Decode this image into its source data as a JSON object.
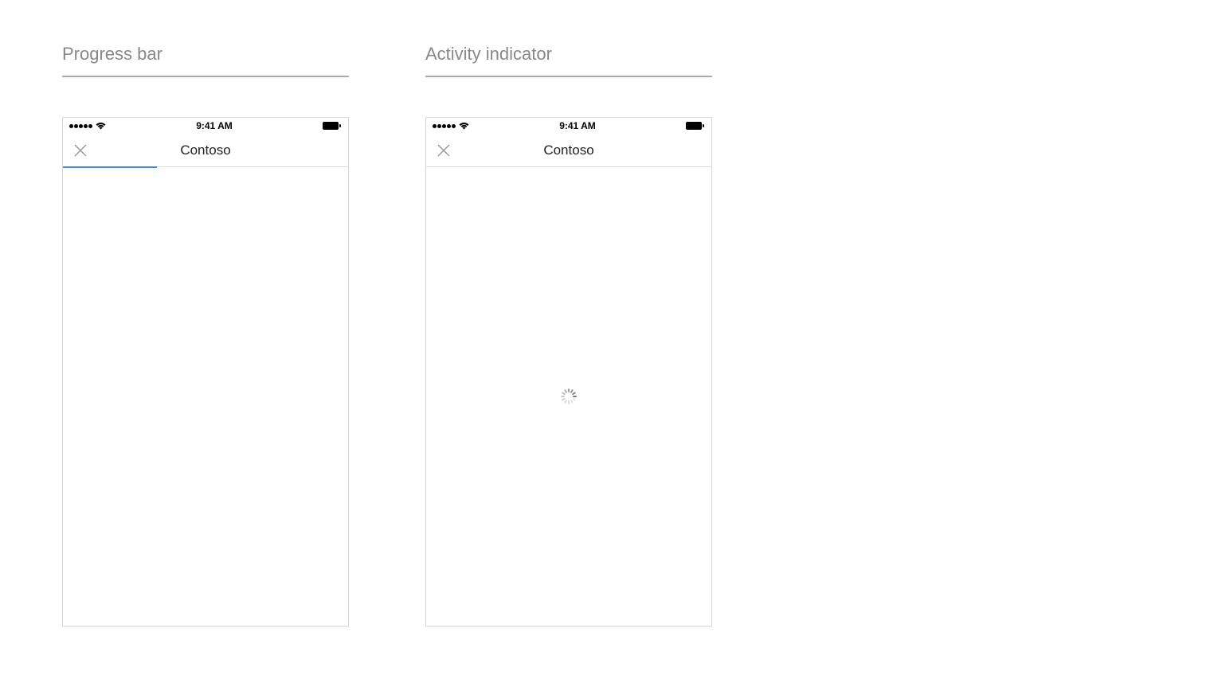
{
  "examples": {
    "progress": {
      "title": "Progress bar",
      "status_time": "9:41 AM",
      "nav_title": "Contoso",
      "progress_percent": 33
    },
    "activity": {
      "title": "Activity indicator",
      "status_time": "9:41 AM",
      "nav_title": "Contoso"
    }
  },
  "colors": {
    "progress_fill": "#3b8ee4",
    "title_gray": "#888888",
    "close_gray": "#999999"
  }
}
